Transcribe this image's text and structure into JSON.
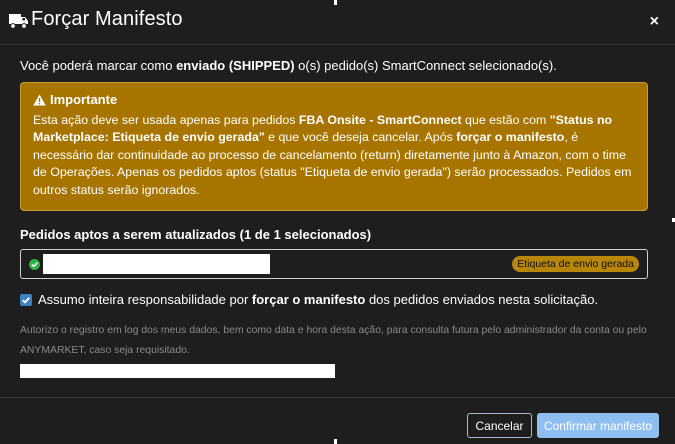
{
  "header": {
    "title": "Forçar Manifesto",
    "title_icon": "truck-icon",
    "close_label": "×"
  },
  "intro": {
    "prefix": "Você poderá marcar como ",
    "bold": "enviado (SHIPPED)",
    "suffix": " o(s) pedido(s) SmartConnect selecionado(s)."
  },
  "alert": {
    "icon": "warning-icon",
    "title": "Importante",
    "t1": "Esta ação deve ser usada apenas para pedidos ",
    "b1": "FBA Onsite - SmartConnect",
    "t2": " que estão com ",
    "b2": "\"Status no Marketplace: Etiqueta de envio gerada\"",
    "t3": " e que você deseja cancelar. Após ",
    "b3": "forçar o manifesto",
    "t4": ", é necessário dar continuidade ao processo de cancelamento (return) diretamente junto à Amazon, com o time de Operações. Apenas os pedidos aptos (status \"Etiqueta de envio gerada\") serão processados. Pedidos em outros status serão ignorados.",
    "color": "#a87400"
  },
  "orders": {
    "section_title": "Pedidos aptos a serem atualizados (1 de 1 selecionados)",
    "items": [
      {
        "id": "",
        "status": "Etiqueta de envio gerada",
        "status_color": "#b7860b"
      }
    ]
  },
  "confirm": {
    "checked": true,
    "prefix": "Assumo inteira responsabilidade por ",
    "bold": "forçar o manifesto",
    "suffix": " dos pedidos enviados nesta solicitação."
  },
  "consent": {
    "text": "Autorizo o registro em log dos meus dados, bem como data e hora desta ação, para consulta futura pelo administrador da conta ou pelo ANYMARKET, caso seja requisitado.",
    "signature_value": ""
  },
  "footer": {
    "cancel_label": "Cancelar",
    "confirm_label": "Confirmar manifesto",
    "confirm_color": "#8fbef0"
  }
}
